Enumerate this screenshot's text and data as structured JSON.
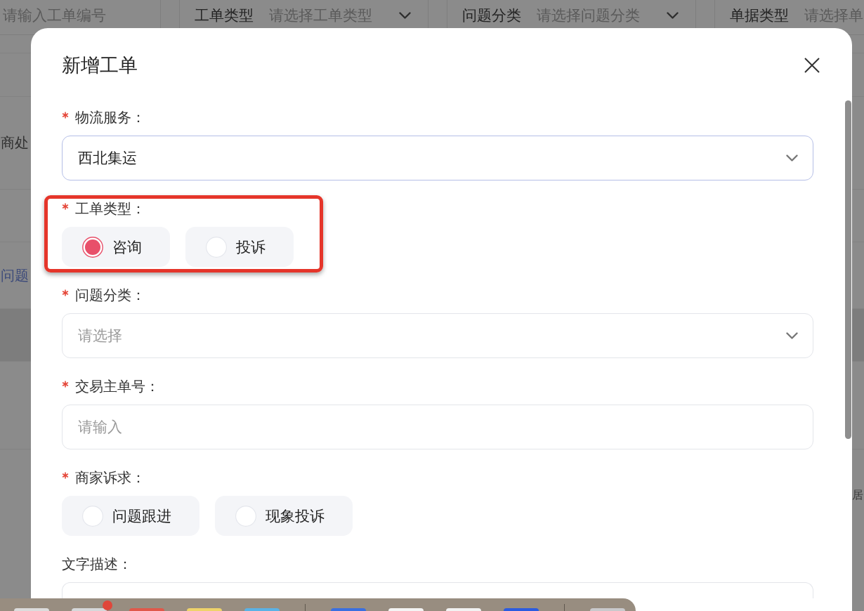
{
  "background_page": {
    "filters": [
      {
        "kind": "input",
        "placeholder": "请输入工单编号"
      },
      {
        "kind": "select",
        "label": "工单类型",
        "placeholder": "请选择工单类型"
      },
      {
        "kind": "select",
        "label": "问题分类",
        "placeholder": "请选择问题分类"
      },
      {
        "kind": "select",
        "label": "单据类型",
        "placeholder": "请选择单"
      }
    ],
    "table": {
      "rows": [
        {
          "kind": "text",
          "first_cell": "商处"
        },
        {
          "kind": "link",
          "first_cell": "问题"
        },
        {
          "kind": "text",
          "last_cell": "居"
        }
      ]
    }
  },
  "dialog": {
    "title": "新增工单",
    "fields": [
      {
        "kind": "select",
        "label": "物流服务：",
        "required": true,
        "focused": true,
        "value": "西北集运"
      },
      {
        "kind": "radio",
        "label": "工单类型：",
        "required": true,
        "annotated": true,
        "options": [
          {
            "label": "咨询",
            "selected": true
          },
          {
            "label": "投诉",
            "selected": false
          }
        ]
      },
      {
        "kind": "select",
        "label": "问题分类：",
        "required": true,
        "focused": false,
        "placeholder": "请选择"
      },
      {
        "kind": "input",
        "label": "交易主单号：",
        "required": true,
        "focused": false,
        "placeholder": "请输入"
      },
      {
        "kind": "radio",
        "label": "商家诉求：",
        "required": true,
        "options": [
          {
            "label": "问题跟进",
            "selected": false
          },
          {
            "label": "现象投诉",
            "selected": false
          }
        ]
      },
      {
        "kind": "textarea",
        "label": "文字描述：",
        "required": false,
        "focused": false
      }
    ]
  }
}
